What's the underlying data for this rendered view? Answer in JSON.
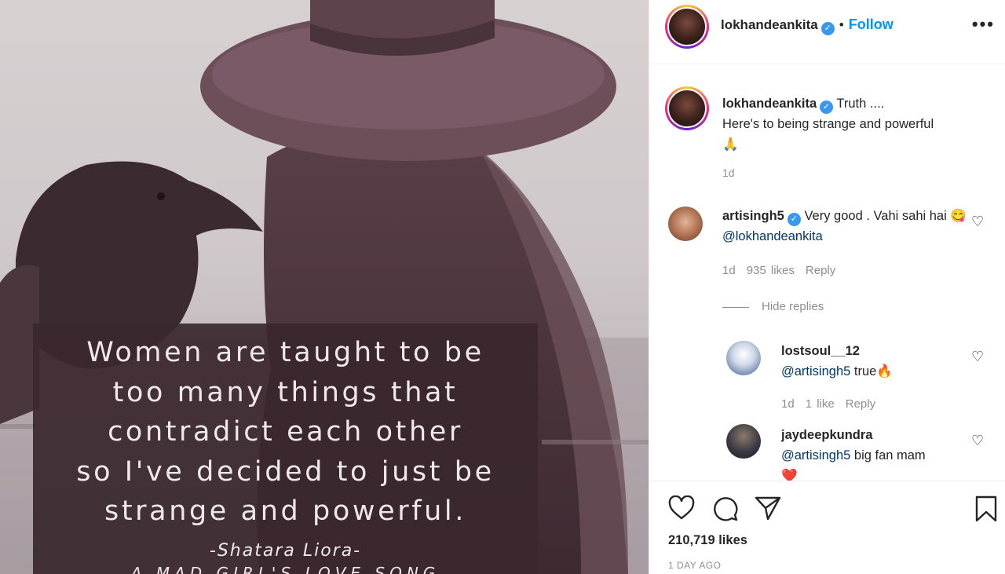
{
  "post": {
    "quote_lines": [
      "Women are taught to be",
      "too many things that",
      "contradict each other",
      "so I've decided to just be",
      "strange and powerful."
    ],
    "quote_author": "-Shatara Liora-",
    "quote_book": "A MAD GIRL'S LOVE SONG"
  },
  "header": {
    "username": "lokhandeankita",
    "separator": "•",
    "follow_label": "Follow",
    "more_label": "•••"
  },
  "caption": {
    "username": "lokhandeankita",
    "line1": "Truth ....",
    "line2": "Here's to being strange and powerful",
    "emoji": "🙏",
    "time": "1d"
  },
  "comments": [
    {
      "username": "artisingh5",
      "text": "Very good . Vahi sahi hai 😋",
      "mention": "@lokhandeankita",
      "time": "1d",
      "likes": "935 likes",
      "reply": "Reply"
    }
  ],
  "hide_replies_label": "Hide replies",
  "replies": [
    {
      "username": "lostsoul__12",
      "mention": "@artisingh5",
      "text": "true🔥",
      "time": "1d",
      "likes": "1 like",
      "reply": "Reply"
    },
    {
      "username": "jaydeepkundra",
      "mention": "@artisingh5",
      "text": "big fan mam",
      "emoji": "❤️"
    }
  ],
  "footer": {
    "likes": "210,719 likes",
    "time_ago": "1 DAY AGO"
  },
  "colors": {
    "accent": "#0095f6",
    "verified": "#3897f0",
    "muted": "#8e8e8e",
    "quote_box": "#3a282e"
  }
}
